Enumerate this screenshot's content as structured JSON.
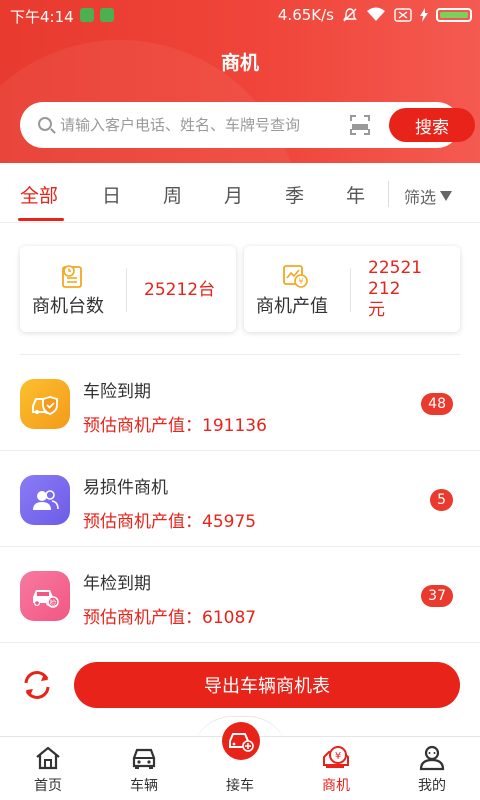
{
  "status_bar": {
    "time": "下午4:14",
    "network_speed": "4.65K/s"
  },
  "header": {
    "title": "商机"
  },
  "search": {
    "placeholder": "请输入客户电话、姓名、车牌号查询",
    "button_label": "搜索"
  },
  "tabs": {
    "items": [
      {
        "label": "全部",
        "active": true
      },
      {
        "label": "日",
        "active": false
      },
      {
        "label": "周",
        "active": false
      },
      {
        "label": "月",
        "active": false
      },
      {
        "label": "季",
        "active": false
      },
      {
        "label": "年",
        "active": false
      }
    ],
    "filter_label": "筛选"
  },
  "summary": {
    "count_label": "商机台数",
    "count_value": "25212台",
    "value_label": "商机产值",
    "value_lines": [
      "22521",
      "212",
      "元"
    ]
  },
  "list": [
    {
      "title": "车险到期",
      "subtitle": "预估商机产值：191136",
      "badge": "48",
      "icon": "car-shield-icon",
      "color": "#f7a91f"
    },
    {
      "title": "易损件商机",
      "subtitle": "预估商机产值：45975",
      "badge": "5",
      "icon": "users-icon",
      "color": "#7b6cf0"
    },
    {
      "title": "年检到期",
      "subtitle": "预估商机产值：61087",
      "badge": "37",
      "icon": "car-inspection-icon",
      "color": "#f5648e"
    }
  ],
  "export": {
    "button_label": "导出车辆商机表"
  },
  "bottom_nav": [
    {
      "label": "首页",
      "icon": "home-icon",
      "active": false
    },
    {
      "label": "车辆",
      "icon": "car-icon",
      "active": false
    },
    {
      "label": "接车",
      "icon": "receive-car-icon",
      "active": false
    },
    {
      "label": "商机",
      "icon": "opportunity-icon",
      "active": true
    },
    {
      "label": "我的",
      "icon": "profile-icon",
      "active": false
    }
  ],
  "colors": {
    "accent": "#e8231a",
    "header": "#f0453a",
    "badge": "#ea3a2e"
  }
}
